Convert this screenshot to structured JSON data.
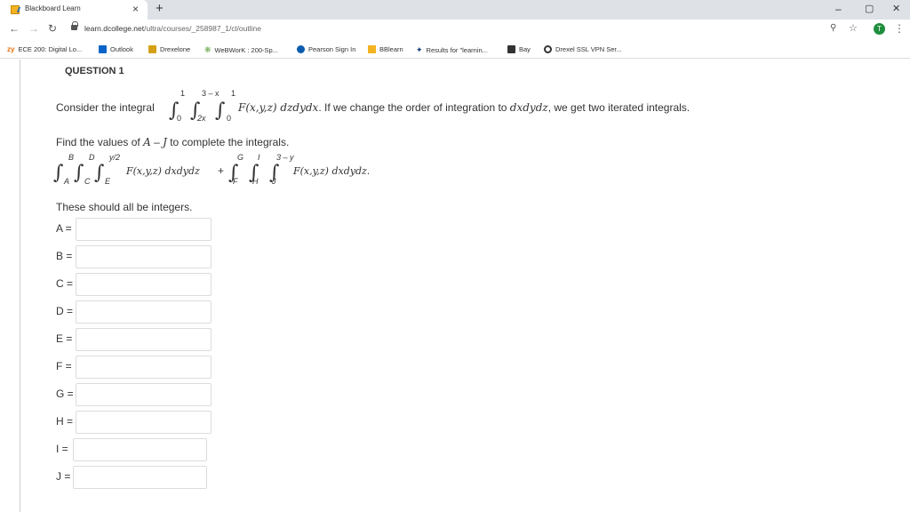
{
  "browser": {
    "tab_title": "Blackboard Learn",
    "tab_close": "×",
    "new_tab": "+",
    "url_host": "learn.dcollege.net",
    "url_path": "/ultra/courses/_258987_1/cl/outline",
    "minimize": "–",
    "maximize": "▢",
    "close": "✕",
    "avatar_letter": "T"
  },
  "bookmarks": [
    {
      "label": "ECE 200: Digital Lo...",
      "icon": "zy-icon",
      "color": "#e8710a"
    },
    {
      "label": "Outlook",
      "icon": "outlook-icon",
      "color": "#0a64c8"
    },
    {
      "label": "Drexelone",
      "icon": "drexelone-icon",
      "color": "#d4a017"
    },
    {
      "label": "WeBWorK : 200-Sp...",
      "icon": "webwork-icon",
      "color": "#6aa84f"
    },
    {
      "label": "Pearson Sign In",
      "icon": "pearson-icon",
      "color": "#0b5cad"
    },
    {
      "label": "BBlearn",
      "icon": "bblearn-icon",
      "color": "#f3b321"
    },
    {
      "label": "Results for \"learnin...",
      "icon": "results-icon",
      "color": "#1a3d7c"
    },
    {
      "label": "Bay",
      "icon": "bay-icon",
      "color": "#333333"
    },
    {
      "label": "Drexel SSL VPN Ser...",
      "icon": "vpn-icon",
      "color": "#333333"
    }
  ],
  "question": {
    "title": "QUESTION 1",
    "consider": "Consider the integral",
    "integrand1": "F(x,y,z) dzdydx",
    "after_integral": ". If we change the order of integration to ",
    "order": "dxdydz",
    "after_order": ", we get two iterated integrals.",
    "find": "Find the values of ",
    "find_A": "A",
    "find_dash": " – ",
    "find_J": "J",
    "find_end": " to complete the integrals.",
    "limits1": {
      "outer_upper": "1",
      "outer_lower": "0",
      "mid_upper": "3 – x",
      "mid_lower": "2x",
      "inner_upper": "1",
      "inner_lower": "0"
    },
    "iterated": {
      "B": "B",
      "A": "A",
      "D": "D",
      "C": "C",
      "upper3": "y/2",
      "E": "E",
      "integrand": "F(x,y,z) dxdydz",
      "plus": "+",
      "G": "G",
      "F": "F",
      "I": "I",
      "H": "H",
      "upper6": "3 – y",
      "J": "J",
      "integrand2": "F(x,y,z) dxdydz."
    },
    "note": "These should all be integers."
  },
  "answers": [
    {
      "label": "A =",
      "value": ""
    },
    {
      "label": "B =",
      "value": ""
    },
    {
      "label": "C =",
      "value": ""
    },
    {
      "label": "D =",
      "value": ""
    },
    {
      "label": "E =",
      "value": ""
    },
    {
      "label": "F =",
      "value": ""
    },
    {
      "label": "G =",
      "value": ""
    },
    {
      "label": "H =",
      "value": ""
    },
    {
      "label": "I =",
      "value": ""
    },
    {
      "label": "J =",
      "value": ""
    }
  ]
}
